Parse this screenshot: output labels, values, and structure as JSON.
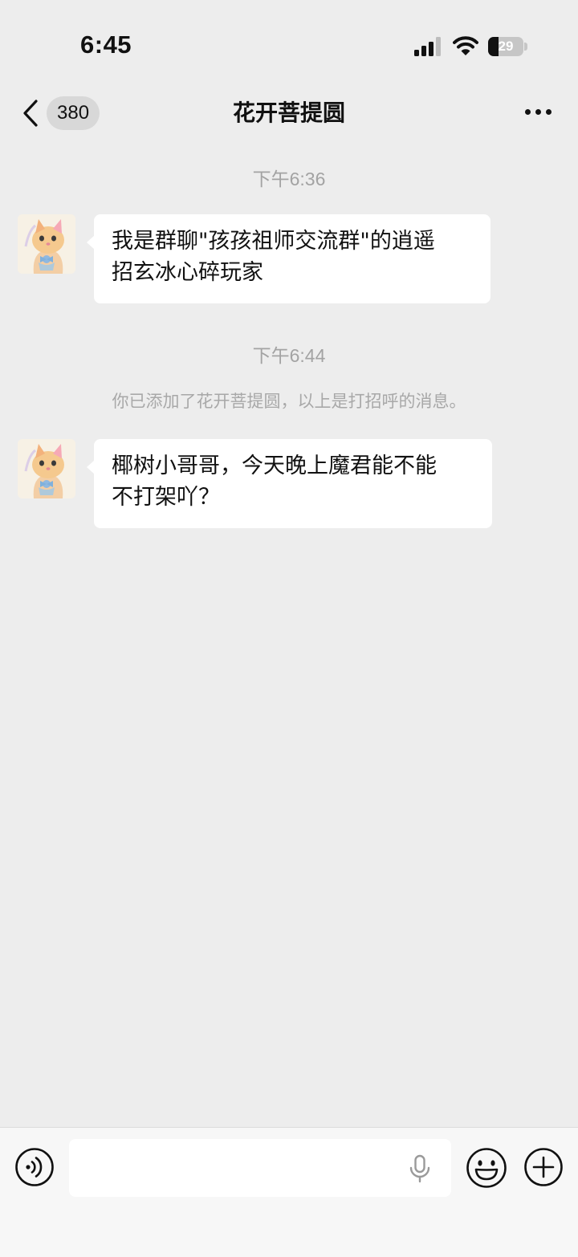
{
  "status_bar": {
    "time": "6:45",
    "battery_level": "29"
  },
  "nav": {
    "unread_count": "380",
    "title": "花开菩提圆",
    "back_icon": "chevron-left-icon",
    "more_icon": "ellipsis-icon"
  },
  "messages": [
    {
      "timestamp": "下午6:36",
      "text_line1": "我是群聊\"孩孩祖师交流群\"的逍遥",
      "text_line2": "招玄冰心碎玩家"
    },
    {
      "timestamp": "下午6:44",
      "system_notice": "你已添加了花开菩提圆，以上是打招呼的消息。",
      "text_line1": "椰树小哥哥，今天晚上魔君能不能",
      "text_line2": "不打架吖？"
    }
  ],
  "input_bar": {
    "voice_icon": "voice-toggle-icon",
    "message_value": "",
    "mic_icon": "microphone-icon",
    "emoji_icon": "emoji-icon",
    "plus_icon": "plus-icon"
  },
  "colors": {
    "background": "#ededed",
    "bubble": "#ffffff",
    "timestamp_text": "#a3a3a3",
    "badge_bg": "#d8d8d8"
  }
}
